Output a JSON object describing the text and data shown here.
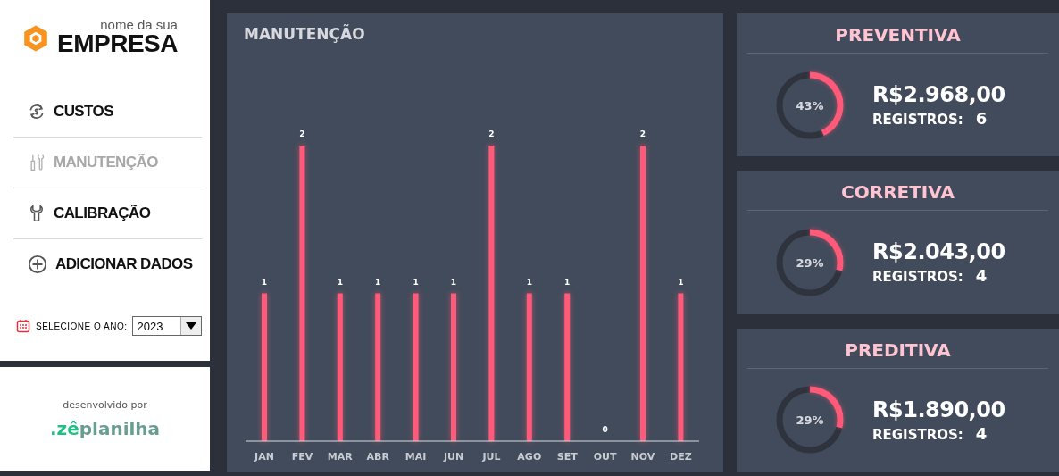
{
  "logo": {
    "small": "nome da sua",
    "big": "EMPRESA"
  },
  "nav": [
    {
      "label": "CUSTOS",
      "kind": "dollar",
      "selected": false
    },
    {
      "label": "MANUTENÇÃO",
      "kind": "tools",
      "selected": true
    },
    {
      "label": "CALIBRAÇÃO",
      "kind": "wrench",
      "selected": false
    },
    {
      "label": "ADICIONAR DADOS",
      "kind": "plus",
      "selected": false
    }
  ],
  "year": {
    "label": "SELECIONE O ANO:",
    "value": "2023"
  },
  "credit": {
    "text": "desenvolvido por",
    "brand_prefix": ".zê",
    "brand_rest": "planilha"
  },
  "chart": {
    "title": "MANUTENÇÃO",
    "chart_data": {
      "type": "bar",
      "categories": [
        "JAN",
        "FEV",
        "MAR",
        "ABR",
        "MAI",
        "JUN",
        "JUL",
        "AGO",
        "SET",
        "OUT",
        "NOV",
        "DEZ"
      ],
      "series": [
        {
          "color": "#ff5a7a",
          "values": [
            1,
            2,
            1,
            1,
            1,
            1,
            2,
            1,
            1,
            0,
            2,
            1
          ]
        }
      ],
      "data_labels": true
    }
  },
  "cards": [
    {
      "title": "PREVENTIVA",
      "percent": "43%",
      "value": "R$2.968,00",
      "records_label": "REGISTROS:",
      "records": "6"
    },
    {
      "title": "CORRETIVA",
      "percent": "29%",
      "value": "R$2.043,00",
      "records_label": "REGISTROS:",
      "records": "4"
    },
    {
      "title": "PREDITIVA",
      "percent": "29%",
      "value": "R$1.890,00",
      "records_label": "REGISTROS:",
      "records": "4"
    }
  ]
}
